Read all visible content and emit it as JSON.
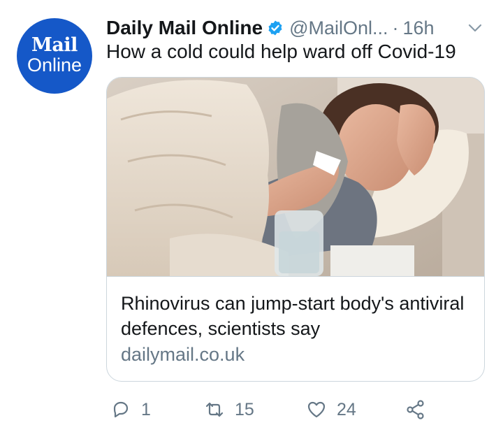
{
  "author": {
    "avatar_line1": "Mail",
    "avatar_line2": "Online",
    "name": "Daily Mail Online",
    "handle": "@MailOnl...",
    "separator": "·",
    "time": "16h"
  },
  "tweet": {
    "text": "How a cold could help ward off Covid-19"
  },
  "card": {
    "title": "Rhinovirus can jump-start body's antiviral defences, scientists say",
    "domain": "dailymail.co.uk"
  },
  "actions": {
    "replies": "1",
    "retweets": "15",
    "likes": "24"
  },
  "colors": {
    "avatar_bg": "#1558c8",
    "verified_blue": "#1da1f2",
    "muted_text": "#657786",
    "border": "#ccd6dd"
  }
}
